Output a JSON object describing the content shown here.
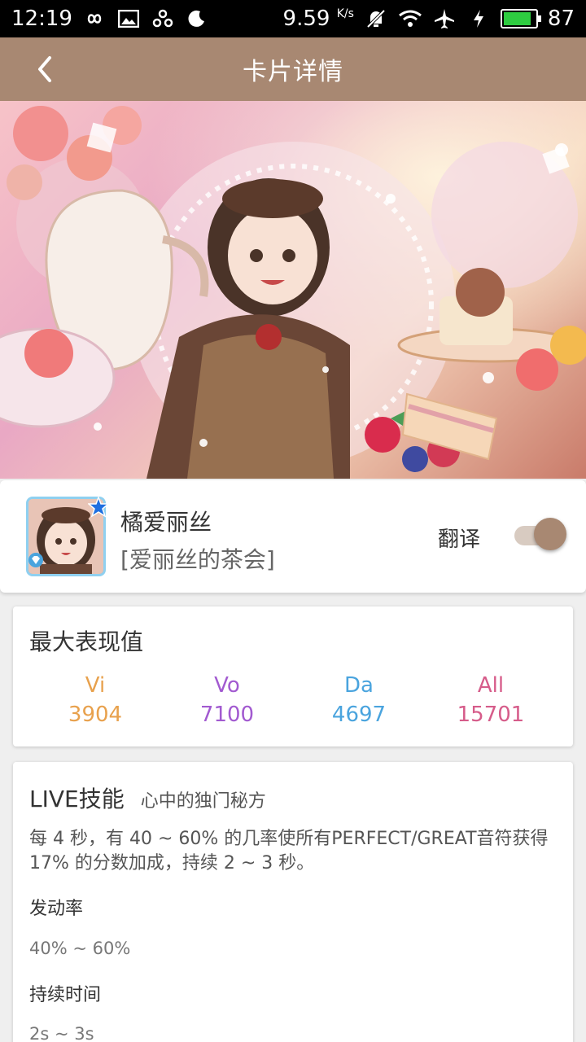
{
  "status_bar": {
    "time": "12:19",
    "speed": "9.59",
    "speed_unit": "K/s",
    "battery": "87",
    "battery_level": 0.87
  },
  "app_bar": {
    "title": "卡片详情"
  },
  "profile": {
    "name": "橘爱丽丝",
    "title": "[爱丽丝的茶会]",
    "translate_label": "翻译",
    "translate_on": true
  },
  "stats": {
    "title": "最大表现值",
    "items": [
      {
        "label": "Vi",
        "value": "3904",
        "color": "#e8a14d"
      },
      {
        "label": "Vo",
        "value": "7100",
        "color": "#a25ad0"
      },
      {
        "label": "Da",
        "value": "4697",
        "color": "#4aa4de"
      },
      {
        "label": "All",
        "value": "15701",
        "color": "#d65c8a"
      }
    ]
  },
  "skill": {
    "title": "LIVE技能",
    "name": "心中的独门秘方",
    "description": "每 4 秒，有 40 ~ 60% 的几率使所有PERFECT/GREAT音符获得 17% 的分数加成，持续 2 ~ 3 秒。",
    "activation_label": "发动率",
    "activation_value": "40% ~ 60%",
    "duration_label": "持续时间",
    "duration_value": "2s ~ 3s"
  },
  "colors": {
    "accent": "#a88872",
    "background": "#efefef"
  }
}
